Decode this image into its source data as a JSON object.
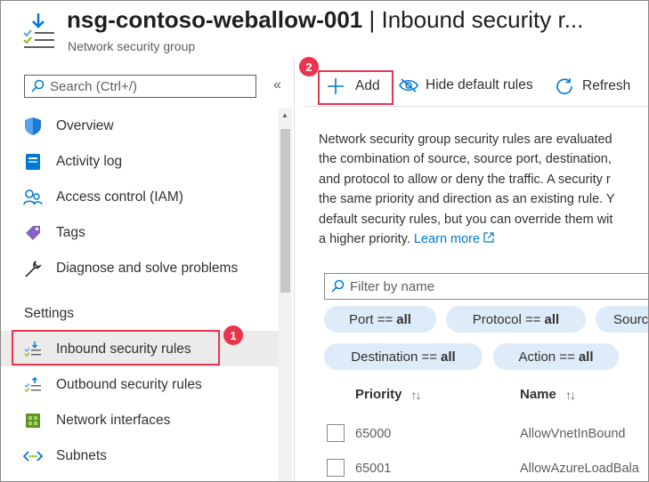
{
  "header": {
    "title_resource": "nsg-contoso-weballow-001",
    "title_separator": " | ",
    "title_page": "Inbound security r...",
    "subtitle": "Network security group"
  },
  "sidebar": {
    "search_placeholder": "Search (Ctrl+/)",
    "collapse_label": "«",
    "items": [
      {
        "label": "Overview",
        "icon": "shield-icon"
      },
      {
        "label": "Activity log",
        "icon": "activity-log-icon"
      },
      {
        "label": "Access control (IAM)",
        "icon": "people-icon"
      },
      {
        "label": "Tags",
        "icon": "tag-icon"
      },
      {
        "label": "Diagnose and solve problems",
        "icon": "wrench-icon"
      }
    ],
    "settings_heading": "Settings",
    "settings_items": [
      {
        "label": "Inbound security rules",
        "icon": "inbound-rules-icon",
        "selected": true
      },
      {
        "label": "Outbound security rules",
        "icon": "outbound-rules-icon"
      },
      {
        "label": "Network interfaces",
        "icon": "nic-icon"
      },
      {
        "label": "Subnets",
        "icon": "subnet-icon"
      }
    ]
  },
  "callouts": {
    "step1": "1",
    "step2": "2"
  },
  "toolbar": {
    "add_label": "Add",
    "hide_default_label": "Hide default rules",
    "refresh_label": "Refresh"
  },
  "description": {
    "lines": [
      "Network security group security rules are evaluated",
      "the combination of source, source port, destination,",
      "and protocol to allow or deny the traffic. A security r",
      "the same priority and direction as an existing rule. Y",
      "default security rules, but you can override them wit"
    ],
    "last_line": "a higher priority.",
    "learn_more": "Learn more"
  },
  "filter": {
    "placeholder": "Filter by name",
    "pills": [
      {
        "key": "Port == ",
        "value": "all"
      },
      {
        "key": "Protocol == ",
        "value": "all"
      },
      {
        "key": "Sourc",
        "value": ""
      },
      {
        "key": "Destination == ",
        "value": "all"
      },
      {
        "key": "Action == ",
        "value": "all"
      }
    ]
  },
  "table": {
    "columns": [
      "Priority",
      "Name"
    ],
    "sort_glyph": "↑↓",
    "rows": [
      {
        "priority": "65000",
        "name": "AllowVnetInBound"
      },
      {
        "priority": "65001",
        "name": "AllowAzureLoadBala"
      }
    ]
  },
  "colors": {
    "accent": "#0078d4",
    "callout": "#e8344e",
    "pill_bg": "#deecf9"
  }
}
